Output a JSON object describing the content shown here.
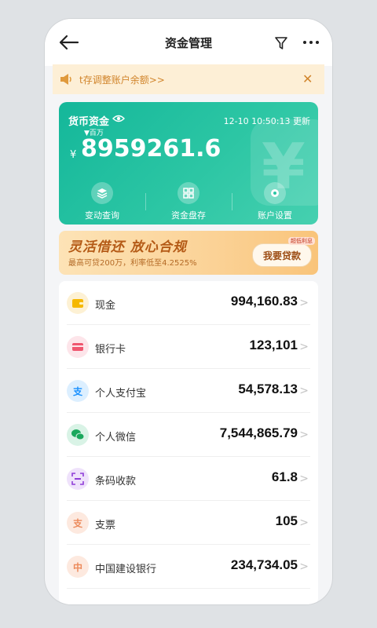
{
  "header": {
    "title": "资金管理"
  },
  "notice": {
    "text": "t存调整账户余额>>",
    "close": "✕"
  },
  "fund_card": {
    "label": "货币资金",
    "time": "12-10 10:50:13 更新",
    "unit": "百万",
    "currency": "¥",
    "amount": "8959261.6",
    "actions": [
      {
        "label": "变动查询"
      },
      {
        "label": "资金盘存"
      },
      {
        "label": "账户设置"
      }
    ]
  },
  "loan": {
    "headline": "灵活借还  放心合规",
    "sub": "最高可贷200万，利率低至4.2525%",
    "button": "我要贷款",
    "tag": "超低利息"
  },
  "accounts": [
    {
      "name": "现金",
      "value": "994,160.83",
      "icon": "wallet-icon",
      "bg": "#fdf1d4",
      "fg": "#f5b800"
    },
    {
      "name": "银行卡",
      "value": "123,101",
      "icon": "card-icon",
      "bg": "#fde5ea",
      "fg": "#f0566f"
    },
    {
      "name": "个人支付宝",
      "value": "54,578.13",
      "icon": "alipay-icon",
      "bg": "#dcefff",
      "fg": "#1790ff",
      "glyph": "支"
    },
    {
      "name": "个人微信",
      "value": "7,544,865.79",
      "icon": "wechat-icon",
      "bg": "#d9f3e6",
      "fg": "#1aa85c"
    },
    {
      "name": "条码收款",
      "value": "61.8",
      "icon": "scan-icon",
      "bg": "#efe2fb",
      "fg": "#8f3dd8"
    },
    {
      "name": "支票",
      "value": "105",
      "icon": "cheque-icon",
      "bg": "#fde9df",
      "fg": "#ec8a5b",
      "glyph": "支"
    },
    {
      "name": "中国建设银行",
      "value": "234,734.05",
      "icon": "bank-icon",
      "bg": "#fde9df",
      "fg": "#ec8a5b",
      "glyph": "中"
    }
  ]
}
